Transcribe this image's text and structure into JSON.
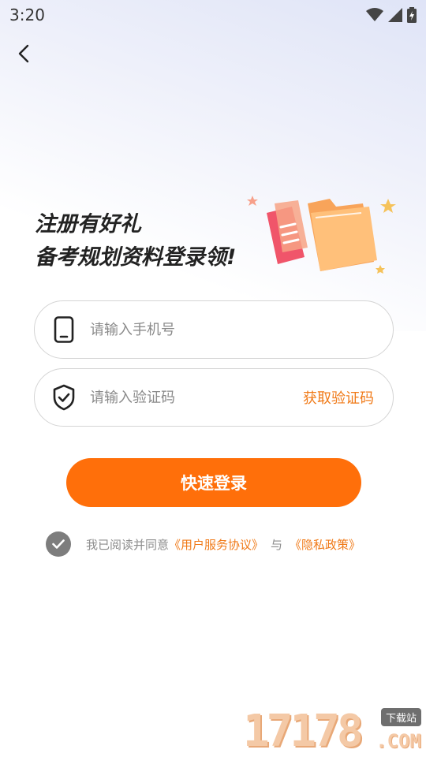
{
  "status_bar": {
    "time": "3:20"
  },
  "headline": {
    "line1": "注册有好礼",
    "line2": "备考规划资料登录领!"
  },
  "phone_field": {
    "placeholder": "请输入手机号",
    "value": ""
  },
  "code_field": {
    "placeholder": "请输入验证码",
    "value": "",
    "get_code_label": "获取验证码"
  },
  "login_button": {
    "label": "快速登录"
  },
  "agreement": {
    "prefix": "我已阅读并同意",
    "user_agreement": "《用户服务协议》",
    "conjunction": "与",
    "privacy_policy": "《隐私政策》",
    "checked": true
  },
  "watermark": {
    "digits": "17178",
    "tag": "下载站",
    "domain": ".COM"
  },
  "colors": {
    "accent": "#ff6f0a",
    "link": "#f07a18",
    "text": "#222222",
    "muted": "#8d8d8d"
  },
  "icons": [
    "back-arrow-icon",
    "wifi-icon",
    "signal-icon",
    "battery-icon",
    "phone-icon",
    "shield-check-icon",
    "checkmark-icon",
    "folder-illustration"
  ]
}
